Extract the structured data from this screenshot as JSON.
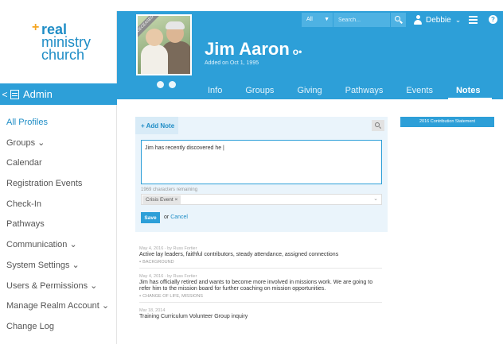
{
  "sidebar": {
    "logo": {
      "plus": "+",
      "line1": "real",
      "line2": "ministry",
      "line3": "church"
    },
    "admin": {
      "chevron": "<",
      "label": "Admin"
    },
    "items": [
      {
        "label": "All Profiles"
      },
      {
        "label": "Groups ⌄"
      },
      {
        "label": "Calendar"
      },
      {
        "label": "Registration Events"
      },
      {
        "label": "Check-In"
      },
      {
        "label": "Pathways"
      },
      {
        "label": "Communication ⌄"
      },
      {
        "label": "System Settings ⌄"
      },
      {
        "label": "Users & Permissions ⌄"
      },
      {
        "label": "Manage Realm Account ⌄"
      },
      {
        "label": "Change Log"
      }
    ]
  },
  "header": {
    "search": {
      "scope": "All",
      "placeholder": "Search..."
    },
    "user": {
      "name": "Debbie",
      "caret": "⌄"
    },
    "help": "?",
    "profile": {
      "name": "Jim Aaron",
      "badge": "o•",
      "subtitle": "Added on Oct 1, 1995",
      "ribbon": "DECEASED"
    },
    "tabs": [
      {
        "label": "Info"
      },
      {
        "label": "Groups"
      },
      {
        "label": "Giving"
      },
      {
        "label": "Pathways"
      },
      {
        "label": "Events"
      },
      {
        "label": "Notes"
      }
    ]
  },
  "notes_editor": {
    "add_label": "+ Add Note",
    "text": "Jim has recently discovered he |",
    "remaining": "1969 characters remaining",
    "tag": "Crisis Event ×",
    "save": "Save",
    "or": "or",
    "cancel": "Cancel"
  },
  "contribution_statement": "2016 Contribution Statement",
  "notes": [
    {
      "meta": "May 4, 2016 · by Russ Fortier",
      "body": "Active lay leaders, faithful contributors, steady attendance, assigned connections",
      "tags": "BACKGROUND"
    },
    {
      "meta": "May 4, 2016 · by Russ Fortier",
      "body": "Jim has officially retired and wants to become more involved in missions work.  We are going to refer him to the mission board for further coaching on mission opportunities.",
      "tags": "CHANGE OF LIFE, MISSIONS"
    },
    {
      "meta": "Mar 18, 2014",
      "body": "Training Curriculum Volunteer Group inquiry",
      "tags": ""
    }
  ],
  "colors": {
    "accent": "#2d9fd8",
    "link": "#1f8dc6",
    "logo_plus": "#f5a623"
  }
}
